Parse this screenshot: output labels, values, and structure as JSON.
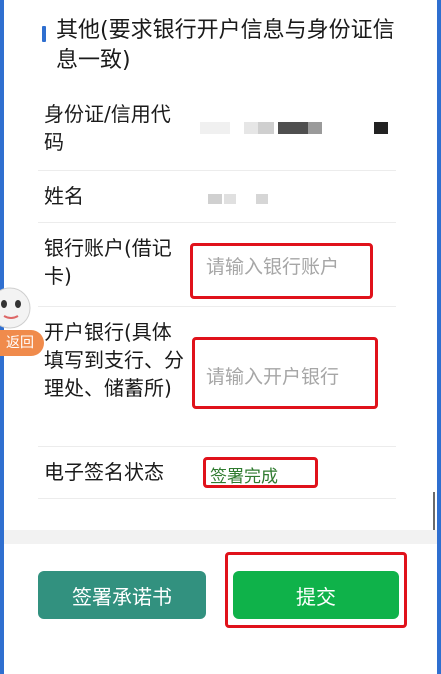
{
  "section": {
    "title": "其他(要求银行开户信息与身份证信息一致)"
  },
  "fields": {
    "id_label": "身份证/信用代码",
    "name_label": "姓名",
    "bank_account_label": "银行账户(借记卡)",
    "bank_account_placeholder": "请输入银行账户",
    "bank_name_label": "开户银行(具体填写到支行、分理处、储蓄所)",
    "bank_name_placeholder": "请输入开户银行",
    "signature_status_label": "电子签名状态",
    "signature_status_value": "签署完成"
  },
  "buttons": {
    "sign_commitment": "签署承诺书",
    "submit": "提交"
  },
  "floating": {
    "back_label": "返回"
  },
  "colors": {
    "accent_blue": "#2f6fd0",
    "highlight_red": "#e0121b",
    "sign_button": "#32917f",
    "submit_button": "#0fb24a",
    "status_green": "#2f7b2f",
    "back_orange": "#f08b4c"
  }
}
